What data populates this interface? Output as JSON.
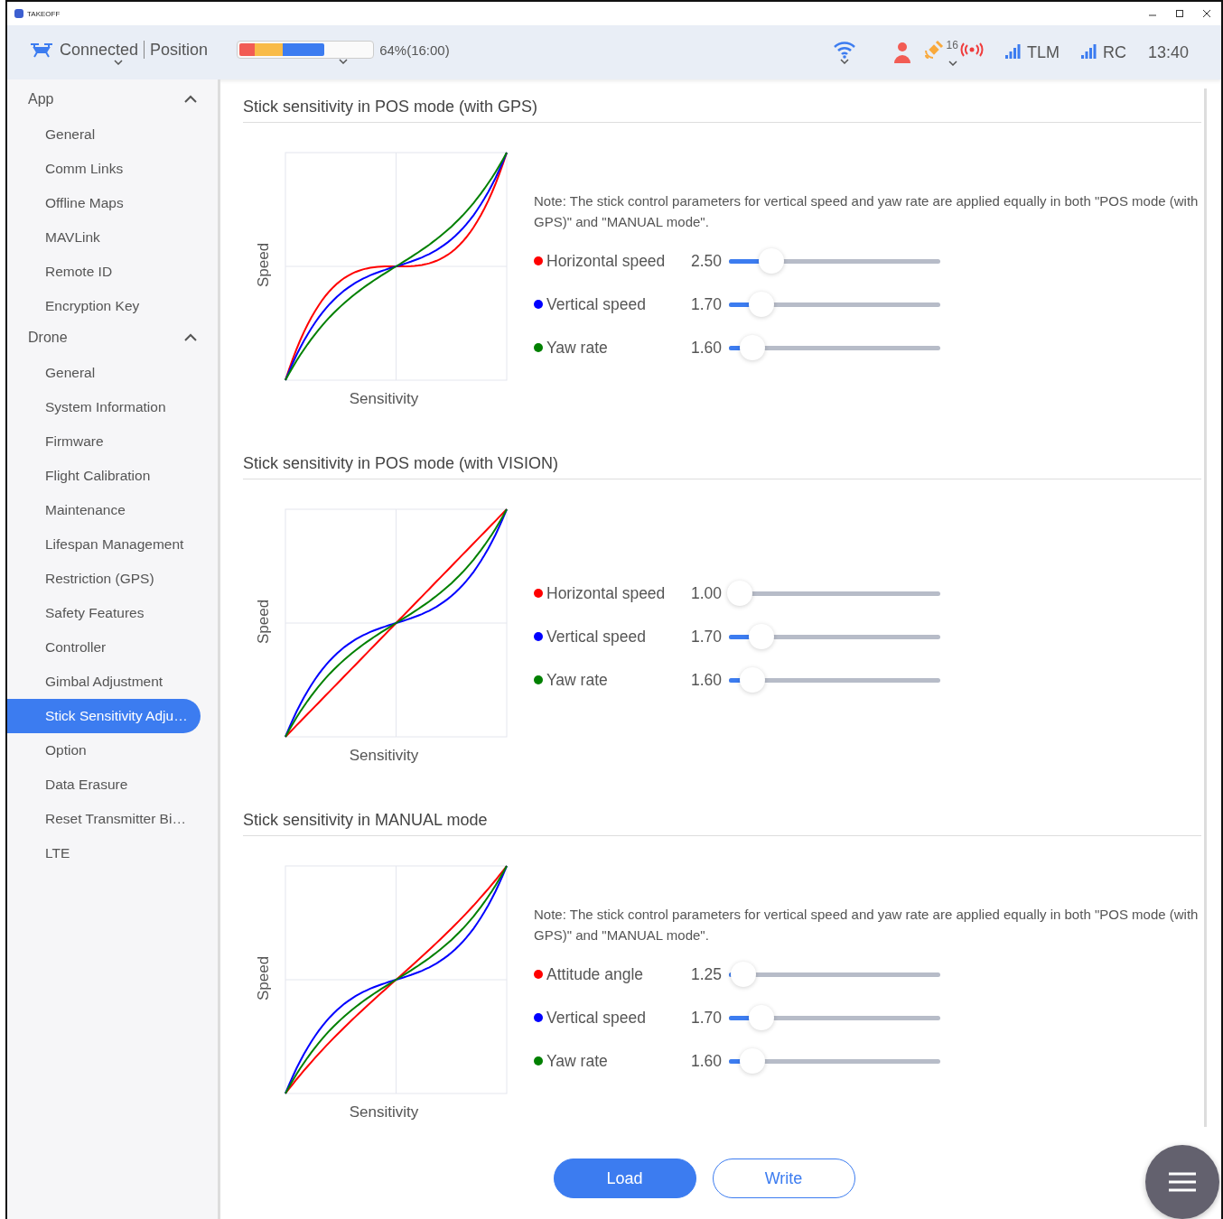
{
  "window": {
    "title": "TAKEOFF"
  },
  "header": {
    "status": "Connected",
    "mode": "Position",
    "battery": {
      "level": 0.64,
      "reading": "64%(16:00)"
    },
    "satellites": "16",
    "tlm": "TLM",
    "rc": "RC",
    "time": "13:40"
  },
  "sidebar": [
    {
      "title": "App",
      "expanded": true,
      "items": [
        {
          "label": "General",
          "selected": false
        },
        {
          "label": "Comm Links",
          "selected": false
        },
        {
          "label": "Offline Maps",
          "selected": false
        },
        {
          "label": "MAVLink",
          "selected": false
        },
        {
          "label": "Remote ID",
          "selected": false
        },
        {
          "label": "Encryption Key",
          "selected": false
        }
      ]
    },
    {
      "title": "Drone",
      "expanded": true,
      "items": [
        {
          "label": "General",
          "selected": false
        },
        {
          "label": "System Information",
          "selected": false
        },
        {
          "label": "Firmware",
          "selected": false
        },
        {
          "label": "Flight Calibration",
          "selected": false
        },
        {
          "label": "Maintenance",
          "selected": false
        },
        {
          "label": "Lifespan Management",
          "selected": false
        },
        {
          "label": "Restriction (GPS)",
          "selected": false
        },
        {
          "label": "Safety Features",
          "selected": false
        },
        {
          "label": "Controller",
          "selected": false
        },
        {
          "label": "Gimbal Adjustment",
          "selected": false
        },
        {
          "label": "Stick Sensitivity Adju…",
          "selected": true
        },
        {
          "label": "Option",
          "selected": false
        },
        {
          "label": "Data Erasure",
          "selected": false
        },
        {
          "label": "Reset Transmitter Bi…",
          "selected": false
        },
        {
          "label": "LTE",
          "selected": false
        }
      ]
    }
  ],
  "sections": [
    {
      "title": "Stick sensitivity in POS mode (with GPS)",
      "ylabel": "Speed",
      "xlabel": "Sensitivity",
      "note": "Note: The stick control parameters for vertical speed and yaw rate are applied equally in both \"POS mode (with GPS)\" and \"MANUAL mode\".",
      "params": [
        {
          "name": "Horizontal speed",
          "color": "#ff0000",
          "reading": "2.50",
          "level": 0.2
        },
        {
          "name": "Vertical speed",
          "color": "#0000ff",
          "reading": "1.70",
          "level": 0.155
        },
        {
          "name": "Yaw rate",
          "color": "#008000",
          "reading": "1.60",
          "level": 0.11
        }
      ]
    },
    {
      "title": "Stick sensitivity in POS mode (with VISION)",
      "ylabel": "Speed",
      "xlabel": "Sensitivity",
      "params": [
        {
          "name": "Horizontal speed",
          "color": "#ff0000",
          "reading": "1.00",
          "level": 0.05
        },
        {
          "name": "Vertical speed",
          "color": "#0000ff",
          "reading": "1.70",
          "level": 0.155
        },
        {
          "name": "Yaw rate",
          "color": "#008000",
          "reading": "1.60",
          "level": 0.11
        }
      ]
    },
    {
      "title": "Stick sensitivity in MANUAL mode",
      "ylabel": "Speed",
      "xlabel": "Sensitivity",
      "note": "Note: The stick control parameters for vertical speed and yaw rate are applied equally in both \"POS mode (with GPS)\" and \"MANUAL mode\".",
      "params": [
        {
          "name": "Attitude angle",
          "color": "#ff0000",
          "reading": "1.25",
          "level": 0.07
        },
        {
          "name": "Vertical speed",
          "color": "#0000ff",
          "reading": "1.70",
          "level": 0.155
        },
        {
          "name": "Yaw rate",
          "color": "#008000",
          "reading": "1.60",
          "level": 0.11
        }
      ]
    }
  ],
  "buttons": {
    "load": "Load",
    "write": "Write"
  }
}
